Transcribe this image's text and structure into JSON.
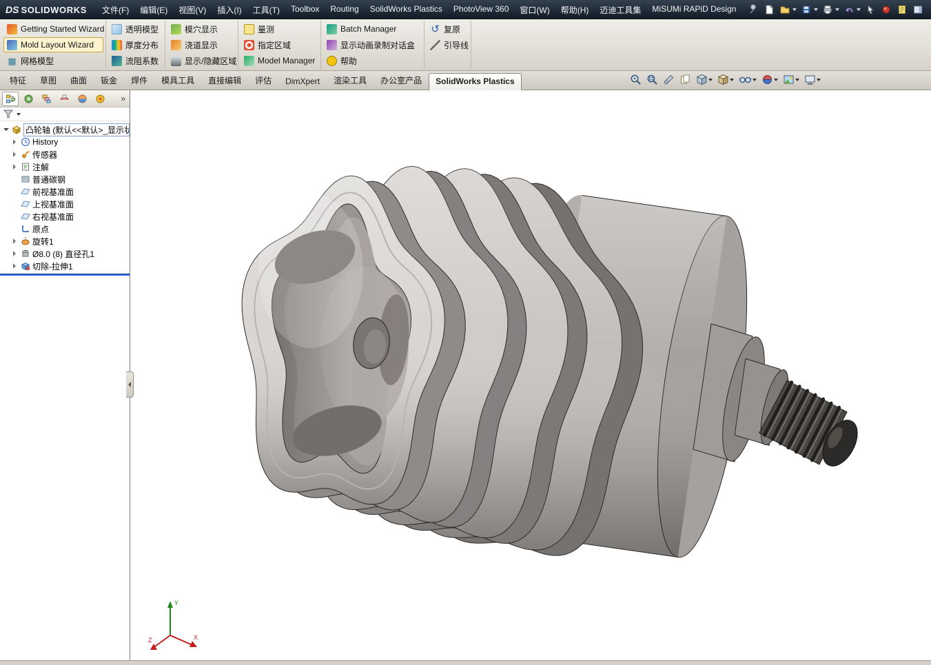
{
  "menubar": {
    "brand_mark": "DS",
    "brand": "SOLIDWORKS",
    "menus": [
      "文件(F)",
      "编辑(E)",
      "视图(V)",
      "插入(I)",
      "工具(T)",
      "Toolbox",
      "Routing",
      "SolidWorks Plastics",
      "PhotoView 360",
      "窗口(W)",
      "帮助(H)",
      "迈迪工具集",
      "MiSUMi RAPiD Design"
    ],
    "quick_icons": [
      "toolbox-wrench-icon",
      "new-document-icon",
      "open-document-icon",
      "save-icon",
      "print-icon",
      "undo-icon",
      "select-pointer-icon",
      "record-icon",
      "properties-document-icon",
      "task-pane-icon"
    ]
  },
  "ribbon": {
    "columns": [
      {
        "items": [
          {
            "label": "Getting Started Wizard",
            "icon": "getting-started-wizard-icon"
          },
          {
            "label": "Mold Layout Wizard",
            "icon": "mold-layout-wizard-icon",
            "selected": true
          },
          {
            "label": "网格模型",
            "icon": "mesh-model-icon"
          }
        ]
      },
      {
        "items": [
          {
            "label": "透明模型",
            "icon": "transparent-model-icon"
          },
          {
            "label": "厚度分布",
            "icon": "thickness-distribution-icon"
          },
          {
            "label": "流阻系数",
            "icon": "flow-resistance-icon"
          }
        ]
      },
      {
        "items": [
          {
            "label": "模穴显示",
            "icon": "cavity-display-icon"
          },
          {
            "label": "浇道显示",
            "icon": "runner-display-icon"
          },
          {
            "label": "显示/隐藏区域",
            "icon": "show-hide-region-icon"
          }
        ]
      },
      {
        "items": [
          {
            "label": "量测",
            "icon": "measure-icon"
          },
          {
            "label": "指定区域",
            "icon": "specify-region-icon"
          },
          {
            "label": "Model Manager",
            "icon": "model-manager-icon"
          }
        ]
      },
      {
        "items": [
          {
            "label": "Batch Manager",
            "icon": "batch-manager-icon"
          },
          {
            "label": "显示动画录制对话盒",
            "icon": "animation-record-dialog-icon"
          },
          {
            "label": "帮助",
            "icon": "plastics-help-icon"
          }
        ]
      },
      {
        "items": [
          {
            "label": "复原",
            "icon": "undo-restore-icon"
          },
          {
            "label": "引导线",
            "icon": "guide-line-icon"
          }
        ]
      }
    ]
  },
  "tabs": [
    {
      "label": "特征"
    },
    {
      "label": "草图"
    },
    {
      "label": "曲面"
    },
    {
      "label": "钣金"
    },
    {
      "label": "焊件"
    },
    {
      "label": "模具工具"
    },
    {
      "label": "直接编辑"
    },
    {
      "label": "评估"
    },
    {
      "label": "DimXpert"
    },
    {
      "label": "渲染工具"
    },
    {
      "label": "办公室产品"
    },
    {
      "label": "SolidWorks Plastics",
      "active": true
    }
  ],
  "hud": {
    "icons": [
      "zoom-fit-icon",
      "zoom-area-icon",
      "section-view-icon",
      "previous-view-icon",
      "view-orientation-icon",
      "display-style-icon",
      "hide-show-items-icon",
      "edit-appearance-icon",
      "apply-scene-icon",
      "view-settings-icon"
    ]
  },
  "left_panel": {
    "manager_tabs": [
      "featuremanager-tab-icon",
      "propertymanager-tab-icon",
      "configurationmanager-tab-icon",
      "dimxpertmanager-tab-icon",
      "displaymanager-tab-icon",
      "plastics-manager-tab-icon"
    ],
    "tree": {
      "items": [
        {
          "label": "凸轮轴 (默认<<默认>_显示状态)",
          "icon": "part-icon"
        },
        {
          "label": "History",
          "icon": "history-folder-icon"
        },
        {
          "label": "传感器",
          "icon": "sensors-icon"
        },
        {
          "label": "注解",
          "icon": "annotations-icon"
        },
        {
          "label": "普通碳钢",
          "icon": "material-icon"
        },
        {
          "label": "前视基准面",
          "icon": "plane-icon"
        },
        {
          "label": "上视基准面",
          "icon": "plane-icon"
        },
        {
          "label": "右视基准面",
          "icon": "plane-icon"
        },
        {
          "label": "原点",
          "icon": "origin-icon"
        },
        {
          "label": "旋转1",
          "icon": "revolve-feature-icon"
        },
        {
          "label": "Ø8.0 (8) 直径孔1",
          "icon": "hole-feature-icon"
        },
        {
          "label": "切除-拉伸1",
          "icon": "cut-extrude-feature-icon"
        }
      ]
    }
  },
  "viewport": {
    "triad": {
      "x": "X",
      "y": "Y",
      "z": "Z"
    }
  },
  "colors": {
    "menubar_bg": "#1c2835",
    "ribbon_bg": "#d8d4cb",
    "rollback_blue": "#2a64d8",
    "selection_yellow": "#fdf3cf",
    "canvas_bg": "#ffffff"
  }
}
